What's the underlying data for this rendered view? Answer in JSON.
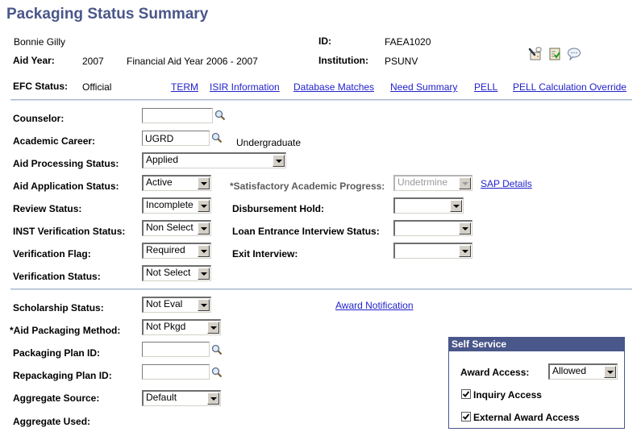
{
  "page": {
    "title": "Packaging Status Summary"
  },
  "header": {
    "student_name": "Bonnie Gilly",
    "id_label": "ID:",
    "id_value": "FAEA1020",
    "aid_year_label": "Aid Year:",
    "aid_year_value": "2007",
    "aid_year_desc": "Financial Aid Year 2006 - 2007",
    "institution_label": "Institution:",
    "institution_value": "PSUNV",
    "efc_status_label": "EFC Status:",
    "efc_status_value": "Official",
    "icons": [
      "contact-log-icon",
      "checklist-icon",
      "comments-icon"
    ]
  },
  "nav_links": [
    {
      "label": "TERM"
    },
    {
      "label": "ISIR Information"
    },
    {
      "label": "Database Matches"
    },
    {
      "label": "Need Summary"
    },
    {
      "label": "PELL"
    },
    {
      "label": "PELL Calculation Override"
    }
  ],
  "form": {
    "counselor": {
      "label": "Counselor:",
      "value": ""
    },
    "academic_career": {
      "label": "Academic Career:",
      "value": "UGRD",
      "desc": "Undergraduate"
    },
    "aid_processing_status": {
      "label": "Aid Processing Status:",
      "value": "Applied"
    },
    "aid_application_status": {
      "label": "Aid Application Status:",
      "value": "Active"
    },
    "review_status": {
      "label": "Review Status:",
      "value": "Incomplete"
    },
    "inst_verification_status": {
      "label": "INST Verification Status:",
      "value": "Non Select"
    },
    "verification_flag": {
      "label": "Verification Flag:",
      "value": "Required"
    },
    "verification_status": {
      "label": "Verification Status:",
      "value": "Not Select"
    },
    "sap": {
      "label": "*Satisfactory Academic Progress:",
      "value": "Undetrmine",
      "link": "SAP Details"
    },
    "disbursement_hold": {
      "label": "Disbursement Hold:",
      "value": ""
    },
    "loan_entrance_interview_status": {
      "label": "Loan Entrance Interview Status:",
      "value": ""
    },
    "exit_interview": {
      "label": "Exit Interview:",
      "value": ""
    },
    "scholarship_status": {
      "label": "Scholarship Status:",
      "value": "Not Eval"
    },
    "aid_packaging_method": {
      "label": "*Aid Packaging Method:",
      "value": "Not Pkgd"
    },
    "packaging_plan_id": {
      "label": "Packaging Plan ID:",
      "value": ""
    },
    "repackaging_plan_id": {
      "label": "Repackaging Plan ID:",
      "value": ""
    },
    "aggregate_source": {
      "label": "Aggregate Source:",
      "value": "Default"
    },
    "aggregate_used": {
      "label": "Aggregate Used:",
      "value": ""
    },
    "award_notification_link": "Award Notification"
  },
  "self_service": {
    "title": "Self Service",
    "award_access": {
      "label": "Award Access:",
      "value": "Allowed"
    },
    "inquiry_access": {
      "label": "Inquiry Access",
      "checked": true
    },
    "external_award_access": {
      "label": "External Award Access",
      "checked": true
    }
  },
  "colors": {
    "title": "#4a578a",
    "link": "#2222cc",
    "panel_header": "#4a578a",
    "divider": "#a9b6cf"
  }
}
